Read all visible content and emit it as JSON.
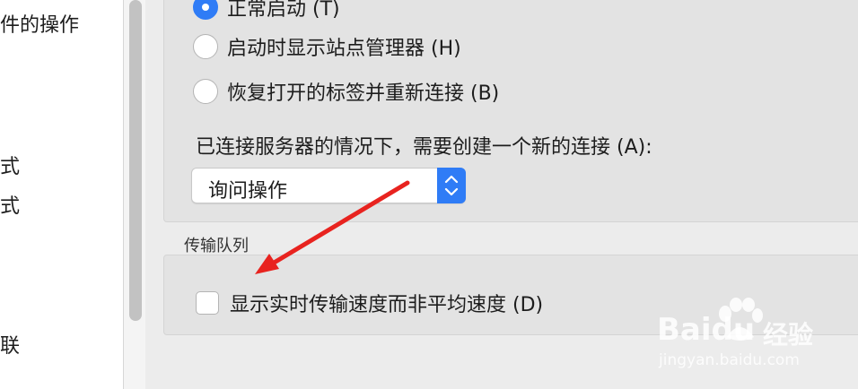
{
  "sidebar": {
    "texts": [
      "件的操作",
      "式",
      "式",
      "联"
    ]
  },
  "startup_group": {
    "options": [
      {
        "label": "正常启动 (T)",
        "checked": true
      },
      {
        "label": "启动时显示站点管理器 (H)",
        "checked": false
      },
      {
        "label": "恢复打开的标签并重新连接 (B)",
        "checked": false
      }
    ],
    "connection_prompt": "已连接服务器的情况下，需要创建一个新的连接 (A):",
    "connection_select_value": "询问操作"
  },
  "transfer_queue": {
    "section_label": "传输队列",
    "checkbox_label": "显示实时传输速度而非平均速度 (D)",
    "checked": false
  },
  "watermark": {
    "brand": "Baidu",
    "brand_cn": "经验",
    "url": "jingyan.baidu.com"
  },
  "colors": {
    "accent": "#2f7cf6",
    "arrow": "#e8231f",
    "background": "#ececec",
    "group_background": "#e3e3e3"
  }
}
